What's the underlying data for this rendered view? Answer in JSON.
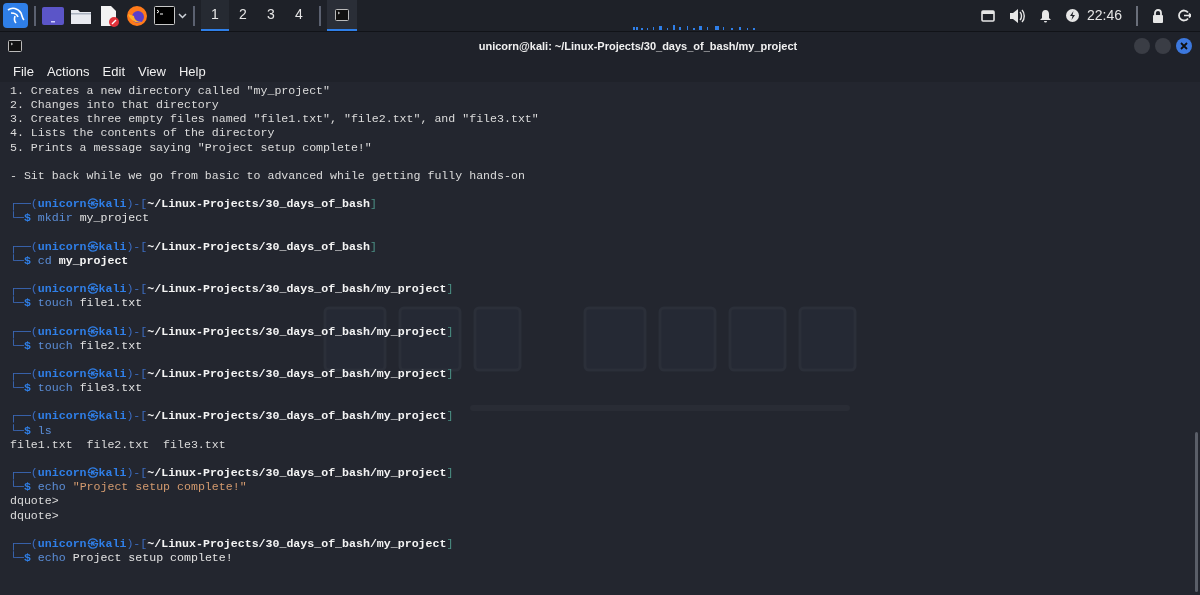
{
  "taskbar": {
    "workspaces": [
      {
        "label": "1",
        "selected": true
      },
      {
        "label": "2",
        "selected": false
      },
      {
        "label": "3",
        "selected": false
      },
      {
        "label": "4",
        "selected": false
      }
    ],
    "tasks": [
      {
        "selected": true
      }
    ],
    "clock": "22:46"
  },
  "window": {
    "title": "unicorn@kali: ~/Linux-Projects/30_days_of_bash/my_project",
    "menu": [
      "File",
      "Actions",
      "Edit",
      "View",
      "Help"
    ],
    "lines": [
      {
        "kind": "text",
        "text": "1. Creates a new directory called \"my_project\""
      },
      {
        "kind": "text",
        "text": "2. Changes into that directory"
      },
      {
        "kind": "text",
        "text": "3. Creates three empty files named \"file1.txt\", \"file2.txt\", and \"file3.txt\""
      },
      {
        "kind": "text",
        "text": "4. Lists the contents of the directory"
      },
      {
        "kind": "text",
        "text": "5. Prints a message saying \"Project setup complete!\""
      },
      {
        "kind": "blank"
      },
      {
        "kind": "text",
        "text": "- Sit back while we go from basic to advanced while getting fully hands-on"
      },
      {
        "kind": "blank"
      },
      {
        "kind": "prompt",
        "user": "unicorn",
        "host": "kali",
        "path": "~/Linux-Projects/30_days_of_bash",
        "open": "┌──(",
        "at": "㉿",
        "mid": ")-[",
        "close": "]"
      },
      {
        "kind": "input",
        "lead": "└─",
        "symbol": "$",
        "command": "mkdir",
        "args": [
          {
            "text": "my_project",
            "kind": "plain"
          }
        ]
      },
      {
        "kind": "blank"
      },
      {
        "kind": "prompt",
        "user": "unicorn",
        "host": "kali",
        "path": "~/Linux-Projects/30_days_of_bash",
        "open": "┌──(",
        "at": "㉿",
        "mid": ")-[",
        "close": "]"
      },
      {
        "kind": "input",
        "lead": "└─",
        "symbol": "$",
        "command": "cd",
        "args": [
          {
            "text": "my_project",
            "kind": "directory"
          }
        ]
      },
      {
        "kind": "blank"
      },
      {
        "kind": "prompt",
        "user": "unicorn",
        "host": "kali",
        "path": "~/Linux-Projects/30_days_of_bash/my_project",
        "open": "┌──(",
        "at": "㉿",
        "mid": ")-[",
        "close": "]"
      },
      {
        "kind": "input",
        "lead": "└─",
        "symbol": "$",
        "command": "touch",
        "args": [
          {
            "text": "file1.txt",
            "kind": "plain"
          }
        ]
      },
      {
        "kind": "blank"
      },
      {
        "kind": "prompt",
        "user": "unicorn",
        "host": "kali",
        "path": "~/Linux-Projects/30_days_of_bash/my_project",
        "open": "┌──(",
        "at": "㉿",
        "mid": ")-[",
        "close": "]"
      },
      {
        "kind": "input",
        "lead": "└─",
        "symbol": "$",
        "command": "touch",
        "args": [
          {
            "text": "file2.txt",
            "kind": "plain"
          }
        ]
      },
      {
        "kind": "blank"
      },
      {
        "kind": "prompt",
        "user": "unicorn",
        "host": "kali",
        "path": "~/Linux-Projects/30_days_of_bash/my_project",
        "open": "┌──(",
        "at": "㉿",
        "mid": ")-[",
        "close": "]"
      },
      {
        "kind": "input",
        "lead": "└─",
        "symbol": "$",
        "command": "touch",
        "args": [
          {
            "text": "file3.txt",
            "kind": "plain"
          }
        ]
      },
      {
        "kind": "blank"
      },
      {
        "kind": "prompt",
        "user": "unicorn",
        "host": "kali",
        "path": "~/Linux-Projects/30_days_of_bash/my_project",
        "open": "┌──(",
        "at": "㉿",
        "mid": ")-[",
        "close": "]"
      },
      {
        "kind": "input",
        "lead": "└─",
        "symbol": "$",
        "command": "ls"
      },
      {
        "kind": "output",
        "text": "file1.txt  file2.txt  file3.txt"
      },
      {
        "kind": "blank"
      },
      {
        "kind": "prompt",
        "user": "unicorn",
        "host": "kali",
        "path": "~/Linux-Projects/30_days_of_bash/my_project",
        "open": "┌──(",
        "at": "㉿",
        "mid": ")-[",
        "close": "]"
      },
      {
        "kind": "input",
        "lead": "└─",
        "symbol": "$",
        "command": "echo",
        "args": [
          {
            "text": "\"Project setup complete!\"",
            "kind": "string"
          }
        ]
      },
      {
        "kind": "output",
        "text": "dquote>"
      },
      {
        "kind": "output",
        "text": "dquote>"
      },
      {
        "kind": "blank"
      },
      {
        "kind": "prompt",
        "user": "unicorn",
        "host": "kali",
        "path": "~/Linux-Projects/30_days_of_bash/my_project",
        "open": "┌──(",
        "at": "㉿",
        "mid": ")-[",
        "close": "]"
      },
      {
        "kind": "input",
        "lead": "└─",
        "symbol": "$",
        "command": "echo",
        "args": [
          {
            "text": "Project",
            "kind": "plain"
          },
          {
            "text": "setup",
            "kind": "plain"
          },
          {
            "text": "complete!",
            "kind": "plain"
          }
        ]
      }
    ]
  }
}
